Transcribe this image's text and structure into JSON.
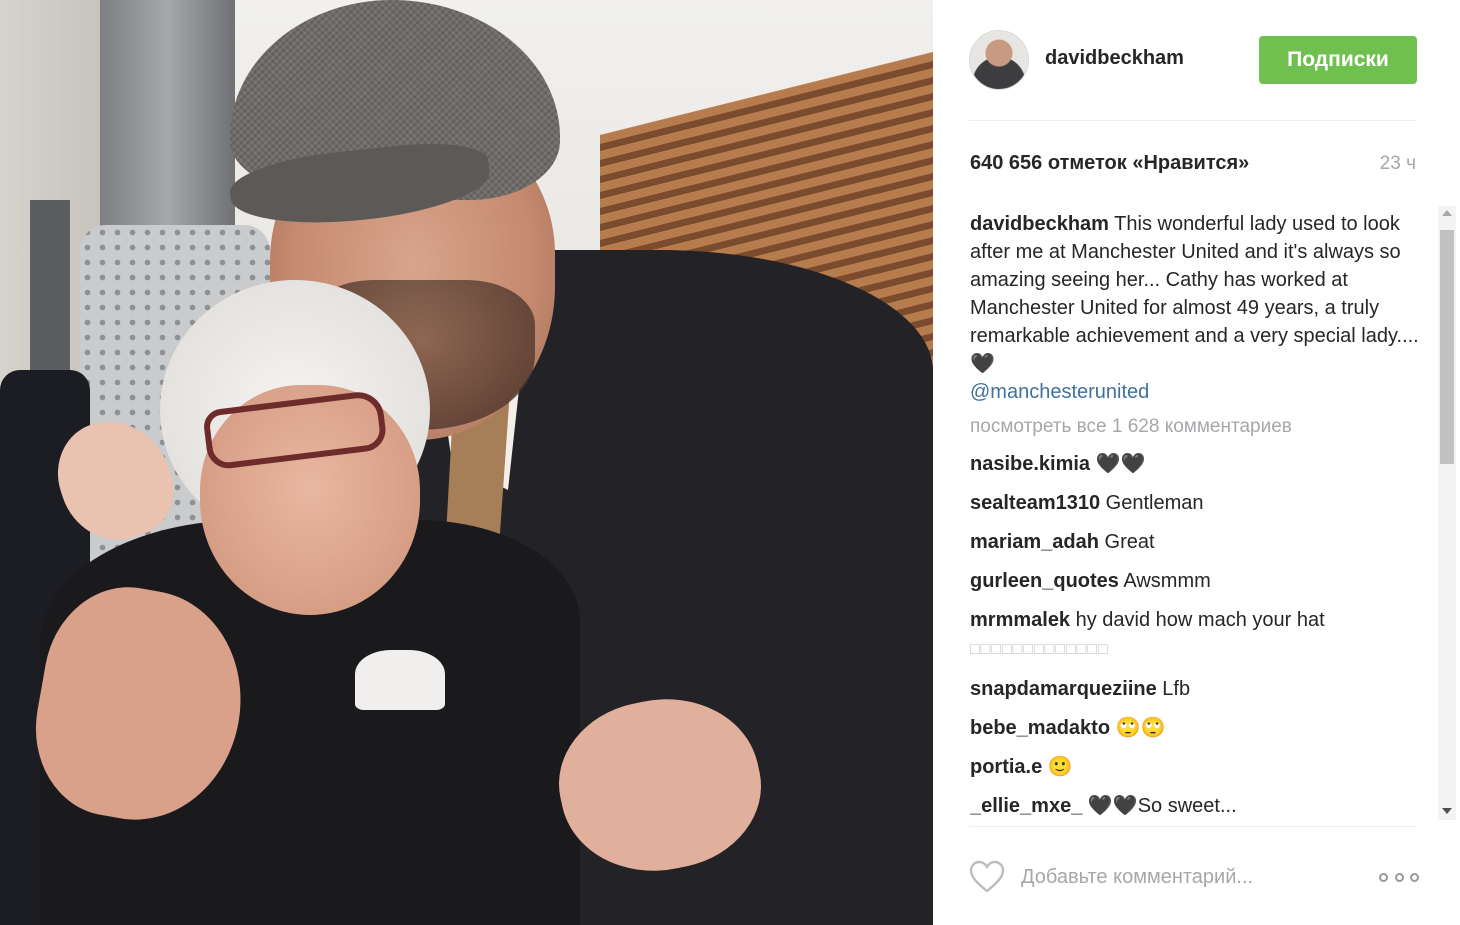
{
  "post": {
    "username": "davidbeckham",
    "follow_label": "Подписки",
    "likes": "640 656 отметок «Нравится»",
    "time": "23 ч",
    "caption": {
      "author": "davidbeckham",
      "text": "This wonderful lady used to look after me at Manchester United and it's always so amazing seeing her... Cathy has worked at Manchester United for almost 49 years, a truly remarkable achievement and a very special lady.... 🖤",
      "mention": "@manchesterunited"
    },
    "view_all": "посмотреть все 1 628 комментариев",
    "comments": [
      {
        "author": "nasibe.kimia",
        "text": "🖤🖤"
      },
      {
        "author": "sealteam1310",
        "text": "Gentleman"
      },
      {
        "author": "mariam_adah",
        "text": "Great"
      },
      {
        "author": "gurleen_quotes",
        "text": "Awsmmm"
      },
      {
        "author": "mrmmalek",
        "text": "hy david how mach your hat",
        "extra": "□□□□□□□□□□□□□"
      },
      {
        "author": "snapdamarqueziine",
        "text": "Lfb"
      },
      {
        "author": "bebe_madakto",
        "text": "🙄🙄"
      },
      {
        "author": "portia.e",
        "text": "🙂"
      },
      {
        "author": "_ellie_mxe_",
        "text": "🖤🖤So sweet..."
      }
    ],
    "comment_placeholder": "Добавьте комментарий...",
    "icons": {
      "avatar": "profile-avatar",
      "like": "heart-icon",
      "more": "more-options-icon"
    },
    "colors": {
      "follow_button": "#70c050",
      "mention": "#3f729b",
      "muted": "#a5a7aa"
    }
  }
}
